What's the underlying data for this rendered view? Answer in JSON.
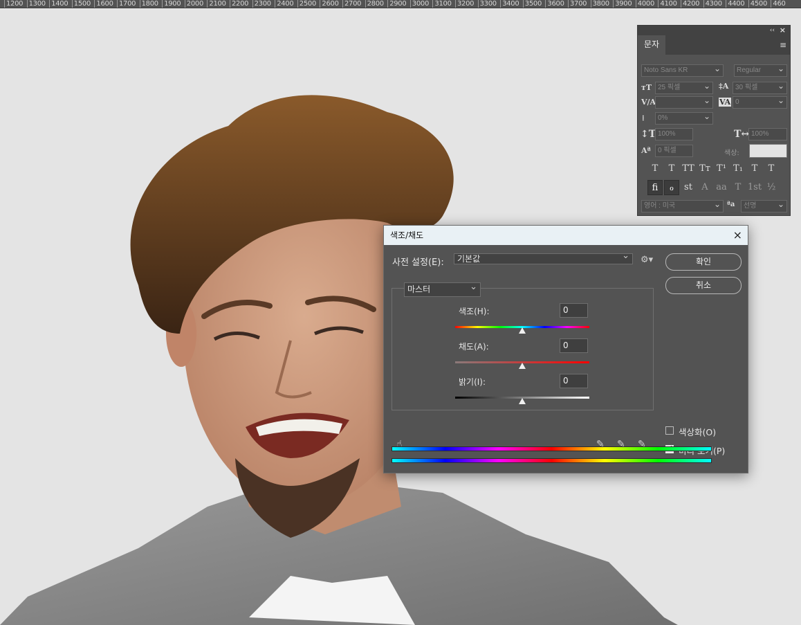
{
  "ruler": {
    "ticks": [
      "1200",
      "1300",
      "1400",
      "1500",
      "1600",
      "1700",
      "1800",
      "1900",
      "2000",
      "2100",
      "2200",
      "2300",
      "2400",
      "2500",
      "2600",
      "2700",
      "2800",
      "2900",
      "3000",
      "3100",
      "3200",
      "3300",
      "3400",
      "3500",
      "3600",
      "3700",
      "3800",
      "3900",
      "4000",
      "4100",
      "4200",
      "4300",
      "4400",
      "4500",
      "460"
    ]
  },
  "canvas": {
    "image_subject": "smiling man with brown hair and goatee in gray shirt"
  },
  "character_panel": {
    "collapse": "‹‹",
    "close": "×",
    "tab": "문자",
    "menu_icon": "≡",
    "font_family": "Noto Sans KR",
    "font_style": "Regular",
    "font_size": "25 픽셀",
    "leading": "30 픽셀",
    "kerning": "",
    "tracking": "0",
    "tsume": "0%",
    "vertical_scale": "100%",
    "horizontal_scale": "100%",
    "baseline_shift": "0 픽셀",
    "color_label": "색상:",
    "color_value": "#e3e3e3",
    "style_buttons": [
      "T",
      "T",
      "TT",
      "Tᴛ",
      "T¹",
      "T₁",
      "T",
      "T"
    ],
    "opentype_buttons": [
      "ﬁ",
      "ℴ",
      "st",
      "A",
      "aa",
      "T",
      "1st",
      "½"
    ],
    "language": "영어 : 미국",
    "aa_label": "ªa",
    "antialias": "선명"
  },
  "dialog": {
    "title": "색조/채도",
    "close": "×",
    "preset_label": "사전 설정(E):",
    "preset_value": "기본값",
    "ok": "확인",
    "cancel": "취소",
    "channel": "마스터",
    "hue_label": "색조(H):",
    "hue_value": "0",
    "saturation_label": "채도(A):",
    "saturation_value": "0",
    "lightness_label": "밝기(I):",
    "lightness_value": "0",
    "colorize_label": "색상화(O)",
    "colorize_checked": false,
    "preview_label": "미리 보기(P)",
    "preview_checked": true,
    "slider_positions": {
      "hue": 0.5,
      "saturation": 0.5,
      "lightness": 0.5
    }
  }
}
